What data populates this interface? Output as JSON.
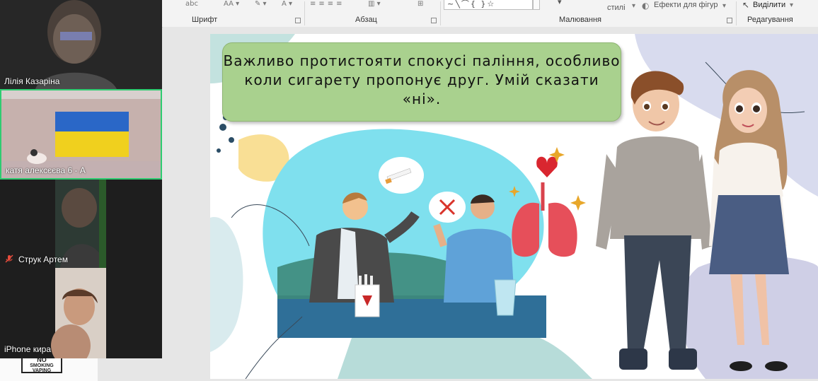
{
  "ribbon": {
    "groups": [
      {
        "label": "Шрифт"
      },
      {
        "label": "Абзац"
      },
      {
        "label": "Малювання"
      },
      {
        "label": "Редагування"
      }
    ],
    "styles_label": "стилі",
    "effects_label": "Ефекти для фігур",
    "select_label": "Виділити"
  },
  "slide": {
    "title": "Важливо протистояти спокусі паління, особливо коли сигарету пропонує друг. Умій сказати «ні»."
  },
  "thumbnail": {
    "badge_line1": "NO",
    "badge_line2": "SMOKING",
    "badge_line3": "VAPING"
  },
  "participants": [
    {
      "name": "Лілія Казаріна",
      "muted": false,
      "active": false
    },
    {
      "name": "катя алексєєва 6 - А",
      "muted": false,
      "active": true
    },
    {
      "name": "Струк Артем",
      "muted": true,
      "active": false
    },
    {
      "name": "iPhone кира",
      "muted": false,
      "active": false
    }
  ],
  "colors": {
    "title_bg": "#a9d18e",
    "active_speaker": "#2ecc71",
    "ribbon_bg": "#f3f3f3"
  }
}
